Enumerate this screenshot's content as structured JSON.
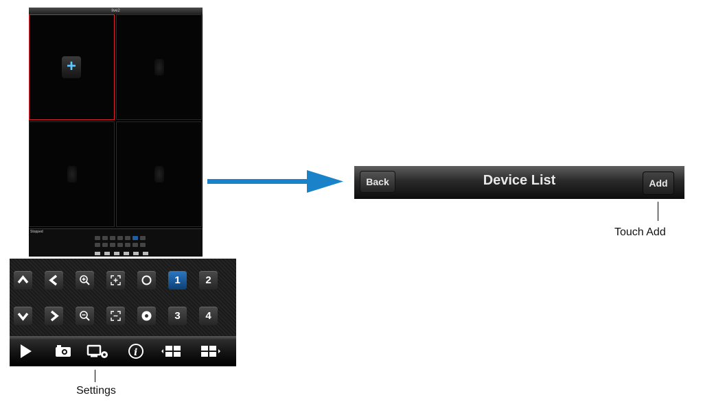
{
  "phone": {
    "title": "live2",
    "status_text": "Stopped"
  },
  "panel": {
    "row1": [
      {
        "name": "tilt-up-button",
        "icon": "chevron-up-icon"
      },
      {
        "name": "pan-left-button",
        "icon": "chevron-left-icon"
      },
      {
        "name": "zoom-in-button",
        "icon": "zoom-in-icon"
      },
      {
        "name": "focus-near-button",
        "icon": "focus-expand-icon"
      },
      {
        "name": "iris-open-button",
        "icon": "iris-open-icon"
      },
      {
        "name": "channel-1-button",
        "label": "1",
        "selected": true
      },
      {
        "name": "channel-2-button",
        "label": "2"
      }
    ],
    "row2": [
      {
        "name": "tilt-down-button",
        "icon": "chevron-down-icon"
      },
      {
        "name": "pan-right-button",
        "icon": "chevron-right-icon"
      },
      {
        "name": "zoom-out-button",
        "icon": "zoom-out-icon"
      },
      {
        "name": "focus-far-button",
        "icon": "focus-collapse-icon"
      },
      {
        "name": "iris-close-button",
        "icon": "iris-close-icon"
      },
      {
        "name": "channel-3-button",
        "label": "3"
      },
      {
        "name": "channel-4-button",
        "label": "4"
      }
    ],
    "nav": [
      "play-icon",
      "snapshot-icon",
      "settings-icon",
      "info-icon",
      "previous-layout-icon",
      "next-layout-icon"
    ],
    "channel_labels": {
      "c1": "1",
      "c2": "2",
      "c3": "3",
      "c4": "4"
    }
  },
  "callouts": {
    "settings": "Settings",
    "touch_add": "Touch Add"
  },
  "device_list": {
    "back_label": "Back",
    "title": "Device List",
    "add_label": "Add"
  },
  "colors": {
    "arrow": "#1a82c8",
    "selected_channel": "#1f66ad",
    "active_cell_border": "#e0202a"
  }
}
